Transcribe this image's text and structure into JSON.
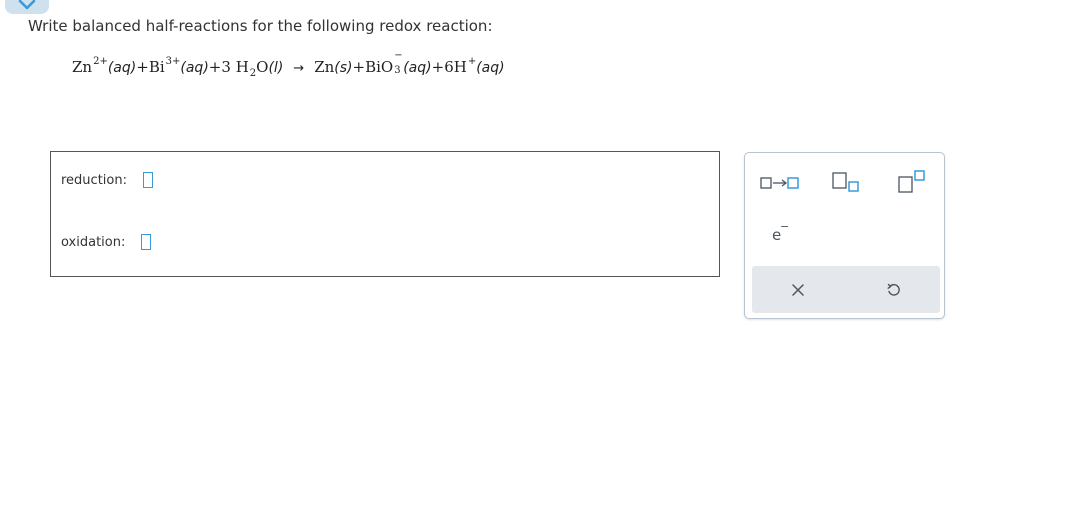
{
  "question": {
    "prompt": "Write balanced half-reactions for the following redox reaction:"
  },
  "equation": {
    "reactants": [
      {
        "formula": "Zn",
        "charge": "2+",
        "state": "(aq)"
      },
      {
        "op": "+"
      },
      {
        "formula": "Bi",
        "charge": "3+",
        "state": "(aq)"
      },
      {
        "op": "+"
      },
      {
        "coeff": "3",
        "formula": "H",
        "sub": "2",
        "formula2": "O",
        "state": "(l)"
      }
    ],
    "arrow": "→",
    "products": [
      {
        "formula": "Zn",
        "state": "(s)"
      },
      {
        "op": "+"
      },
      {
        "formula": "BiO",
        "sub": "3",
        "charge": "−",
        "state": "(aq)"
      },
      {
        "op": "+"
      },
      {
        "coeff": "6",
        "formula": "H",
        "charge": "+",
        "state": "(aq)"
      }
    ]
  },
  "answer": {
    "reduction_label": "reduction:",
    "oxidation_label": "oxidation:"
  },
  "toolbar": {
    "electron_symbol": "e",
    "electron_charge": "−",
    "icons": [
      "reaction-arrow-template-icon",
      "subscript-template-icon",
      "superscript-template-icon",
      "electron-icon",
      "clear-icon",
      "undo-icon"
    ],
    "accent_color": "#3a9ad9",
    "icon_color": "#4a5560"
  }
}
